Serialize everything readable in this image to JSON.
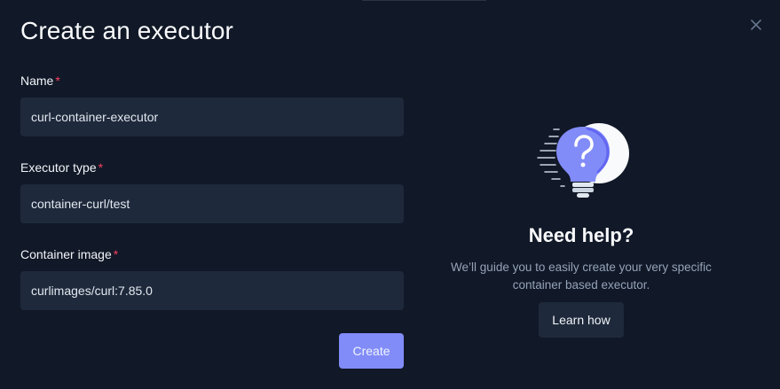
{
  "modal": {
    "title": "Create an executor",
    "close_icon": "close-icon"
  },
  "form": {
    "required_marker": "*",
    "name": {
      "label": "Name",
      "value": "curl-container-executor"
    },
    "executor_type": {
      "label": "Executor type",
      "value": "container-curl/test"
    },
    "container_image": {
      "label": "Container image",
      "value": "curlimages/curl:7.85.0"
    },
    "submit_label": "Create"
  },
  "help": {
    "illustration": "lightbulb-question-icon",
    "title": "Need help?",
    "description": "We’ll guide you to easily create your very specific container based executor.",
    "button_label": "Learn how"
  },
  "colors": {
    "background": "#111827",
    "input_bg": "#1e293b",
    "accent": "#818cf8",
    "required": "#f43f5e"
  }
}
